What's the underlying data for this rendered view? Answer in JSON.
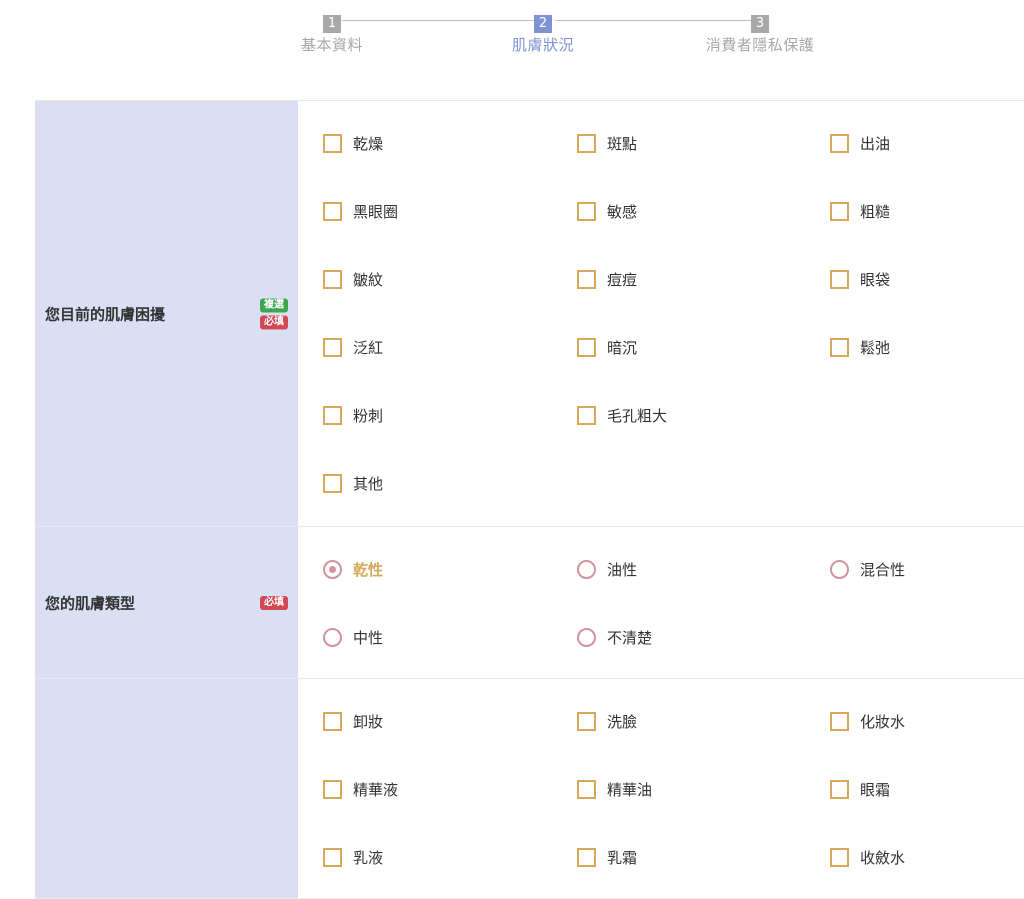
{
  "stepper": {
    "steps": [
      {
        "num": "1",
        "label": "基本資料"
      },
      {
        "num": "2",
        "label": "肌膚狀況"
      },
      {
        "num": "3",
        "label": "消費者隱私保護"
      }
    ],
    "active_index": 1
  },
  "badges": {
    "multi": "複選",
    "required": "必填"
  },
  "questions": [
    {
      "title": "您目前的肌膚困擾",
      "input_type": "checkbox",
      "options": [
        "乾燥",
        "斑點",
        "出油",
        "黑眼圈",
        "敏感",
        "粗糙",
        "皺紋",
        "痘痘",
        "眼袋",
        "泛紅",
        "暗沉",
        "鬆弛",
        "粉刺",
        "毛孔粗大",
        "其他"
      ]
    },
    {
      "title": "您的肌膚類型",
      "input_type": "radio",
      "selected": "乾性",
      "options": [
        "乾性",
        "油性",
        "混合性",
        "中性",
        "不清楚"
      ]
    },
    {
      "title": "",
      "input_type": "checkbox",
      "options": [
        "卸妝",
        "洗臉",
        "化妝水",
        "精華液",
        "精華油",
        "眼霜",
        "乳液",
        "乳霜",
        "收斂水"
      ]
    }
  ],
  "colors": {
    "accent": "#7f93d3",
    "inactive": "#a8a8a8",
    "label_bg": "#dadff4",
    "checkbox_border": "#d6a85a",
    "radio_border": "#d1949e",
    "badge_multi": "#3ba84f",
    "badge_required": "#d24853"
  }
}
